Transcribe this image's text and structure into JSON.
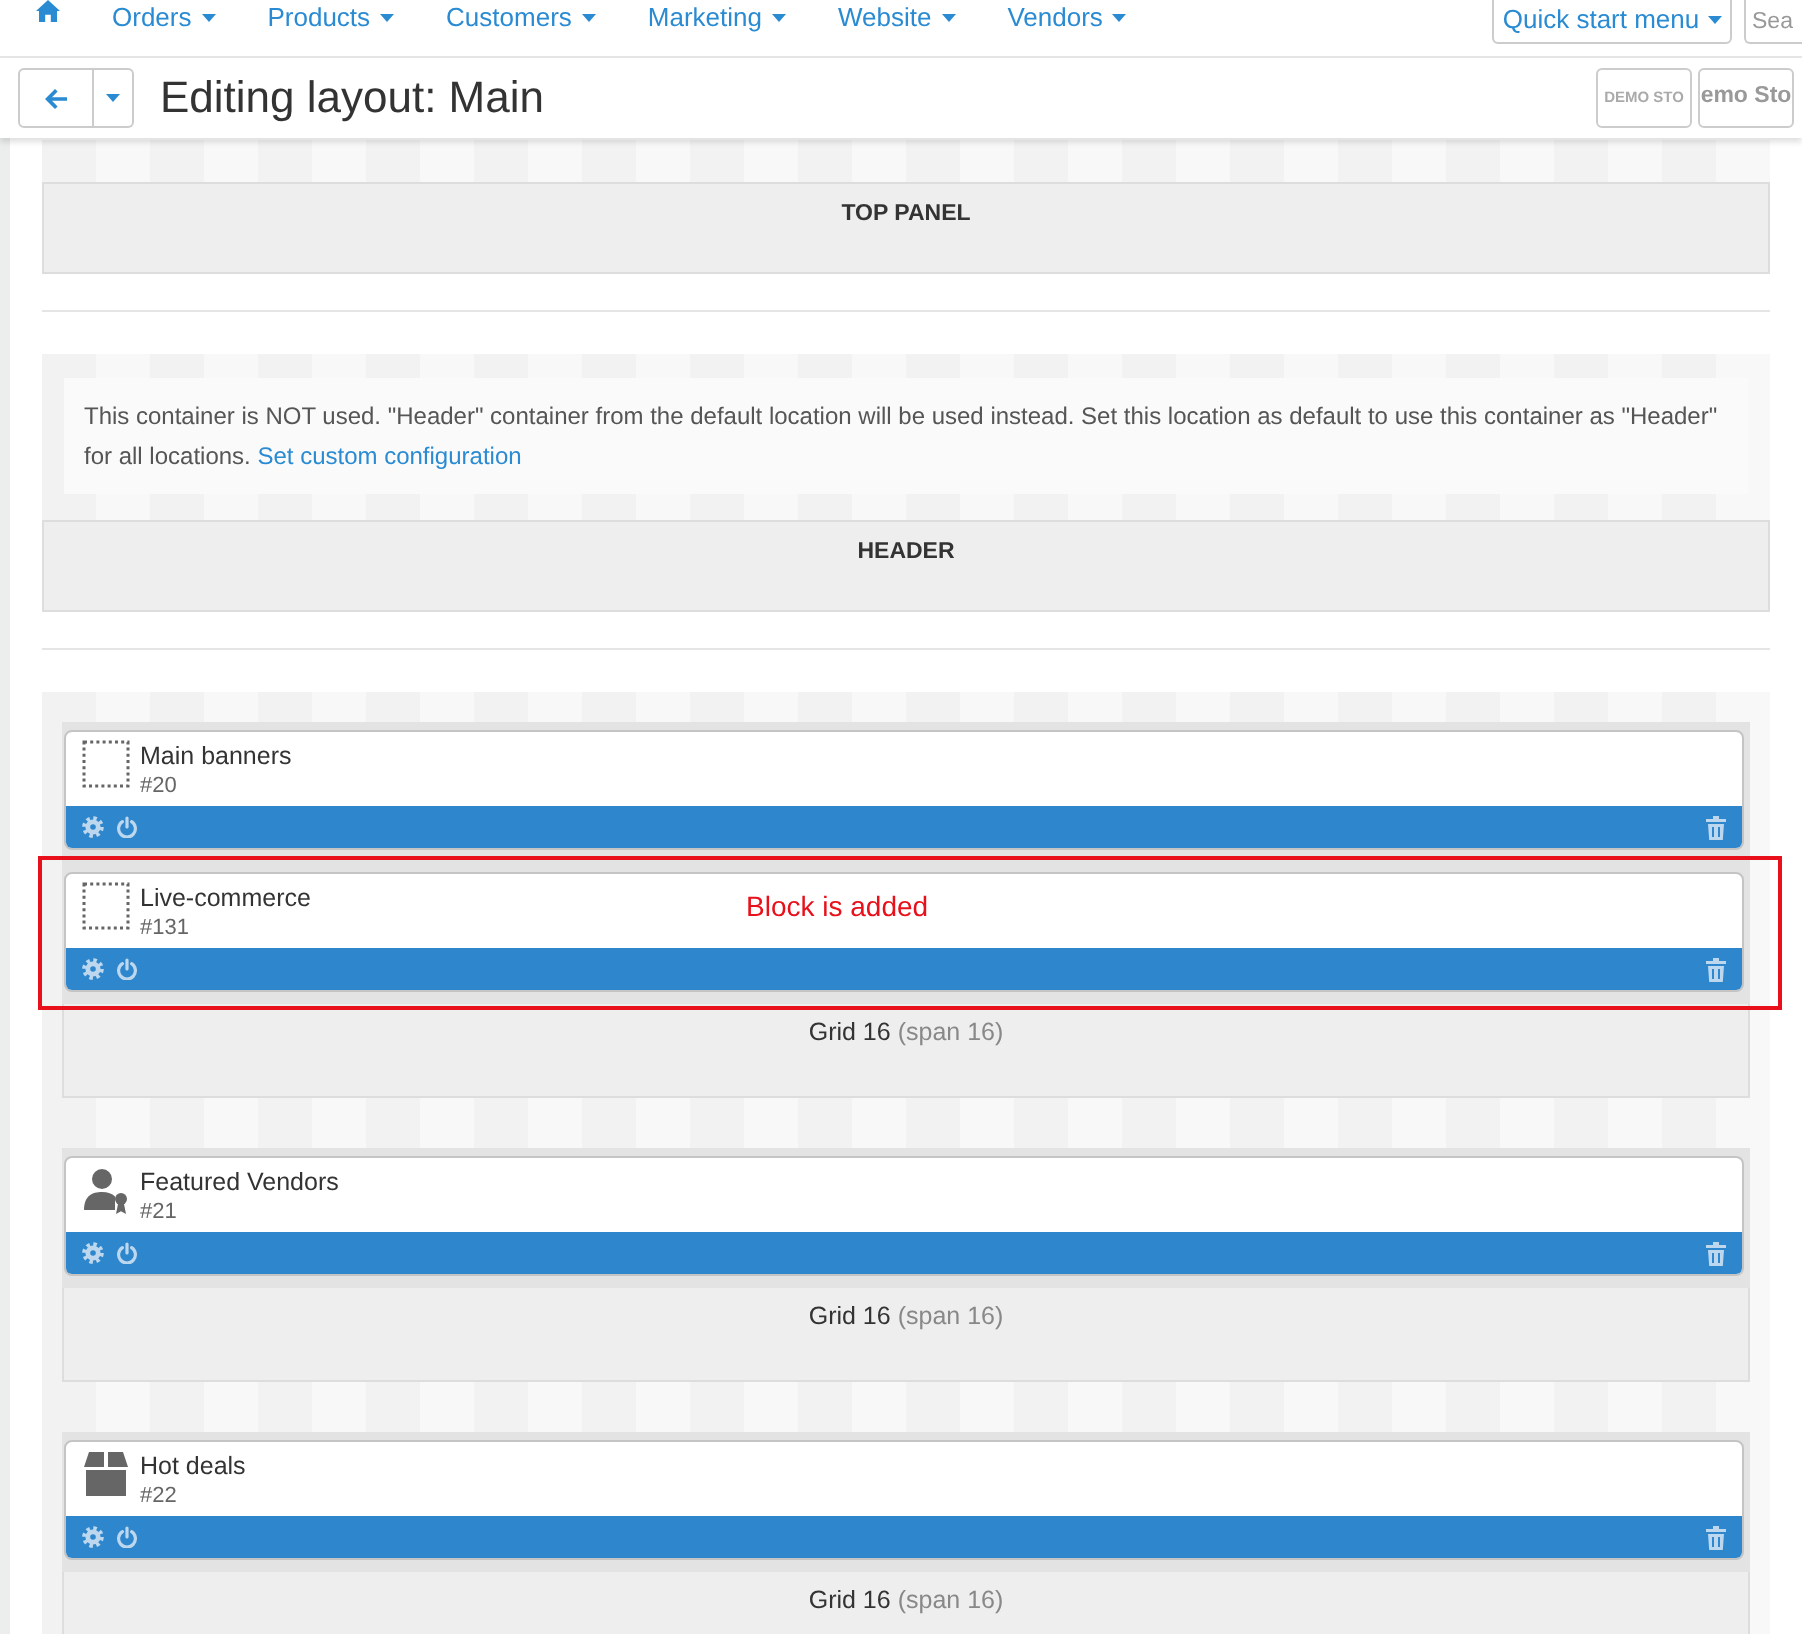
{
  "top_nav": {
    "items": [
      {
        "label": "Orders"
      },
      {
        "label": "Products"
      },
      {
        "label": "Customers"
      },
      {
        "label": "Marketing"
      },
      {
        "label": "Website"
      },
      {
        "label": "Vendors"
      }
    ],
    "quick_start": {
      "label": "Quick start menu"
    },
    "search": {
      "placeholder": "Sea"
    }
  },
  "toolbar": {
    "title": "Editing layout: Main",
    "store_logos": [
      {
        "kind": "small",
        "label": "DEMO STO"
      },
      {
        "kind": "large",
        "label": "emo Sto"
      }
    ]
  },
  "containers": [
    {
      "kind": "panel",
      "label": "TOP PANEL"
    },
    {
      "kind": "panel",
      "notice": {
        "text": "This container is NOT used. \"Header\" container from the default location will be used instead. Set this location as default to use this container as \"Header\" for all locations.",
        "link": "Set custom configuration"
      },
      "label": "HEADER"
    },
    {
      "kind": "grids",
      "grids": [
        {
          "title": "Grid 16",
          "span": "(span 16)",
          "blocks": [
            {
              "kind": "dotted",
              "name": "Main banners",
              "number": "#20"
            },
            {
              "kind": "dotted",
              "name": "Live-commerce",
              "number": "#131",
              "annotation": "Block is added"
            }
          ]
        },
        {
          "title": "Grid 16",
          "span": "(span 16)",
          "blocks": [
            {
              "kind": "person",
              "name": "Featured Vendors",
              "number": "#21"
            }
          ]
        },
        {
          "title": "Grid 16",
          "span": "(span 16)",
          "blocks": [
            {
              "kind": "box",
              "name": "Hot deals",
              "number": "#22"
            }
          ]
        }
      ]
    }
  ]
}
